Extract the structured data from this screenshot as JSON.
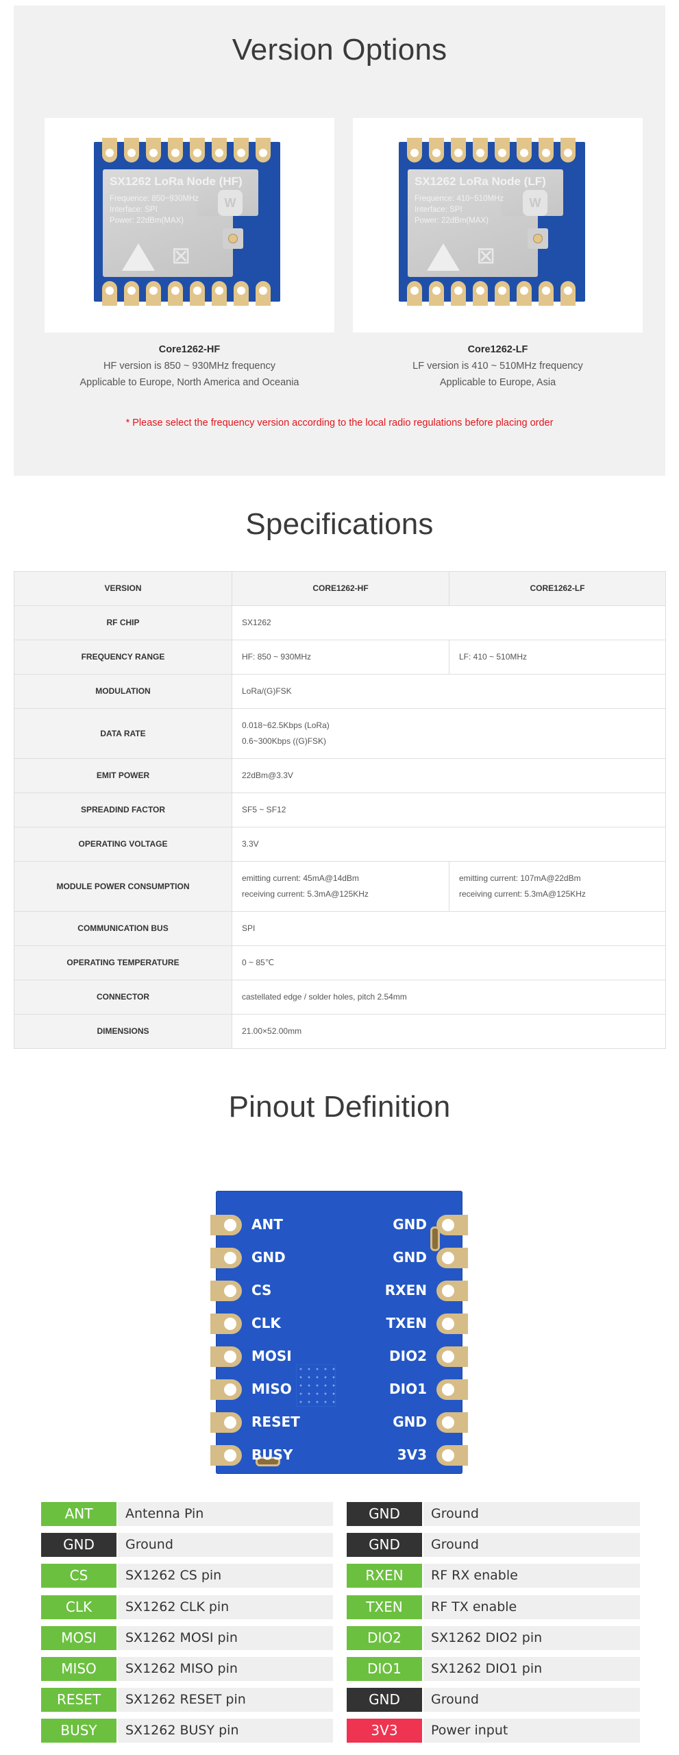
{
  "version_options": {
    "title": "Version Options",
    "cards": [
      {
        "name": "Core1262-HF",
        "line1": "HF version is 850 ~ 930MHz frequency",
        "line2": "Applicable to Europe, North America and Oceania",
        "module": {
          "title": "SX1262 LoRa Node (HF)",
          "frequence": "Frequence: 850~930MHz",
          "interface": "Interface: SPI",
          "power": "Power: 22dBm(MAX)"
        }
      },
      {
        "name": "Core1262-LF",
        "line1": "LF version is 410 ~ 510MHz frequency",
        "line2": "Applicable to Europe, Asia",
        "module": {
          "title": "SX1262 LoRa Node (LF)",
          "frequence": "Frequence: 410~510MHz",
          "interface": "Interface: SPI",
          "power": "Power: 22dBm(MAX)"
        }
      }
    ],
    "logo_text": "W",
    "note": "* Please select the frequency version according to the local radio regulations before placing order",
    "note_color": "#e3161d"
  },
  "specifications": {
    "title": "Specifications",
    "header": [
      "VERSION",
      "CORE1262-HF",
      "CORE1262-LF"
    ],
    "rows": [
      {
        "key": "RF CHIP",
        "value": "SX1262"
      },
      {
        "key": "FREQUENCY RANGE",
        "hf": "HF: 850 ~ 930MHz",
        "lf": "LF: 410 ~ 510MHz"
      },
      {
        "key": "MODULATION",
        "value": "LoRa/(G)FSK"
      },
      {
        "key": "DATA RATE",
        "value_lines": [
          "0.018~62.5Kbps (LoRa)",
          "0.6~300Kbps ((G)FSK)"
        ]
      },
      {
        "key": "EMIT POWER",
        "value": "22dBm@3.3V"
      },
      {
        "key": "SPREADIND FACTOR",
        "value": "SF5 ~ SF12"
      },
      {
        "key": "OPERATING VOLTAGE",
        "value": "3.3V"
      },
      {
        "key": "MODULE POWER CONSUMPTION",
        "hf_lines": [
          "emitting current: 45mA@14dBm",
          "receiving current: 5.3mA@125KHz"
        ],
        "lf_lines": [
          "emitting current: 107mA@22dBm",
          "receiving current: 5.3mA@125KHz"
        ]
      },
      {
        "key": "COMMUNICATION BUS",
        "value": "SPI"
      },
      {
        "key": "OPERATING TEMPERATURE",
        "value": "0 ~ 85℃"
      },
      {
        "key": "CONNECTOR",
        "value": "castellated edge / solder holes, pitch 2.54mm"
      },
      {
        "key": "DIMENSIONS",
        "value": "21.00×52.00mm"
      }
    ]
  },
  "pinout": {
    "title": "Pinout Definition",
    "board_left_labels": [
      "ANT",
      "GND",
      "CS",
      "CLK",
      "MOSI",
      "MISO",
      "RESET",
      "BUSY"
    ],
    "board_right_labels": [
      "GND",
      "GND",
      "RXEN",
      "TXEN",
      "DIO2",
      "DIO1",
      "GND",
      "3V3"
    ],
    "colors": {
      "signal": "#6cc040",
      "ground": "#333333",
      "power": "#ee3450"
    },
    "left_pins": [
      {
        "pin": "ANT",
        "desc": "Antenna Pin",
        "type": "signal"
      },
      {
        "pin": "GND",
        "desc": "Ground",
        "type": "ground"
      },
      {
        "pin": "CS",
        "desc": "SX1262 CS pin",
        "type": "signal"
      },
      {
        "pin": "CLK",
        "desc": "SX1262 CLK pin",
        "type": "signal"
      },
      {
        "pin": "MOSI",
        "desc": "SX1262 MOSI pin",
        "type": "signal"
      },
      {
        "pin": "MISO",
        "desc": "SX1262 MISO pin",
        "type": "signal"
      },
      {
        "pin": "RESET",
        "desc": "SX1262 RESET pin",
        "type": "signal"
      },
      {
        "pin": "BUSY",
        "desc": "SX1262 BUSY pin",
        "type": "signal"
      }
    ],
    "right_pins": [
      {
        "pin": "GND",
        "desc": "Ground",
        "type": "ground"
      },
      {
        "pin": "GND",
        "desc": "Ground",
        "type": "ground"
      },
      {
        "pin": "RXEN",
        "desc": "RF RX enable",
        "type": "signal"
      },
      {
        "pin": "TXEN",
        "desc": "RF TX enable",
        "type": "signal"
      },
      {
        "pin": "DIO2",
        "desc": "SX1262 DIO2 pin",
        "type": "signal"
      },
      {
        "pin": "DIO1",
        "desc": "SX1262 DIO1 pin",
        "type": "signal"
      },
      {
        "pin": "GND",
        "desc": "Ground",
        "type": "ground"
      },
      {
        "pin": "3V3",
        "desc": "Power input",
        "type": "power"
      }
    ]
  }
}
